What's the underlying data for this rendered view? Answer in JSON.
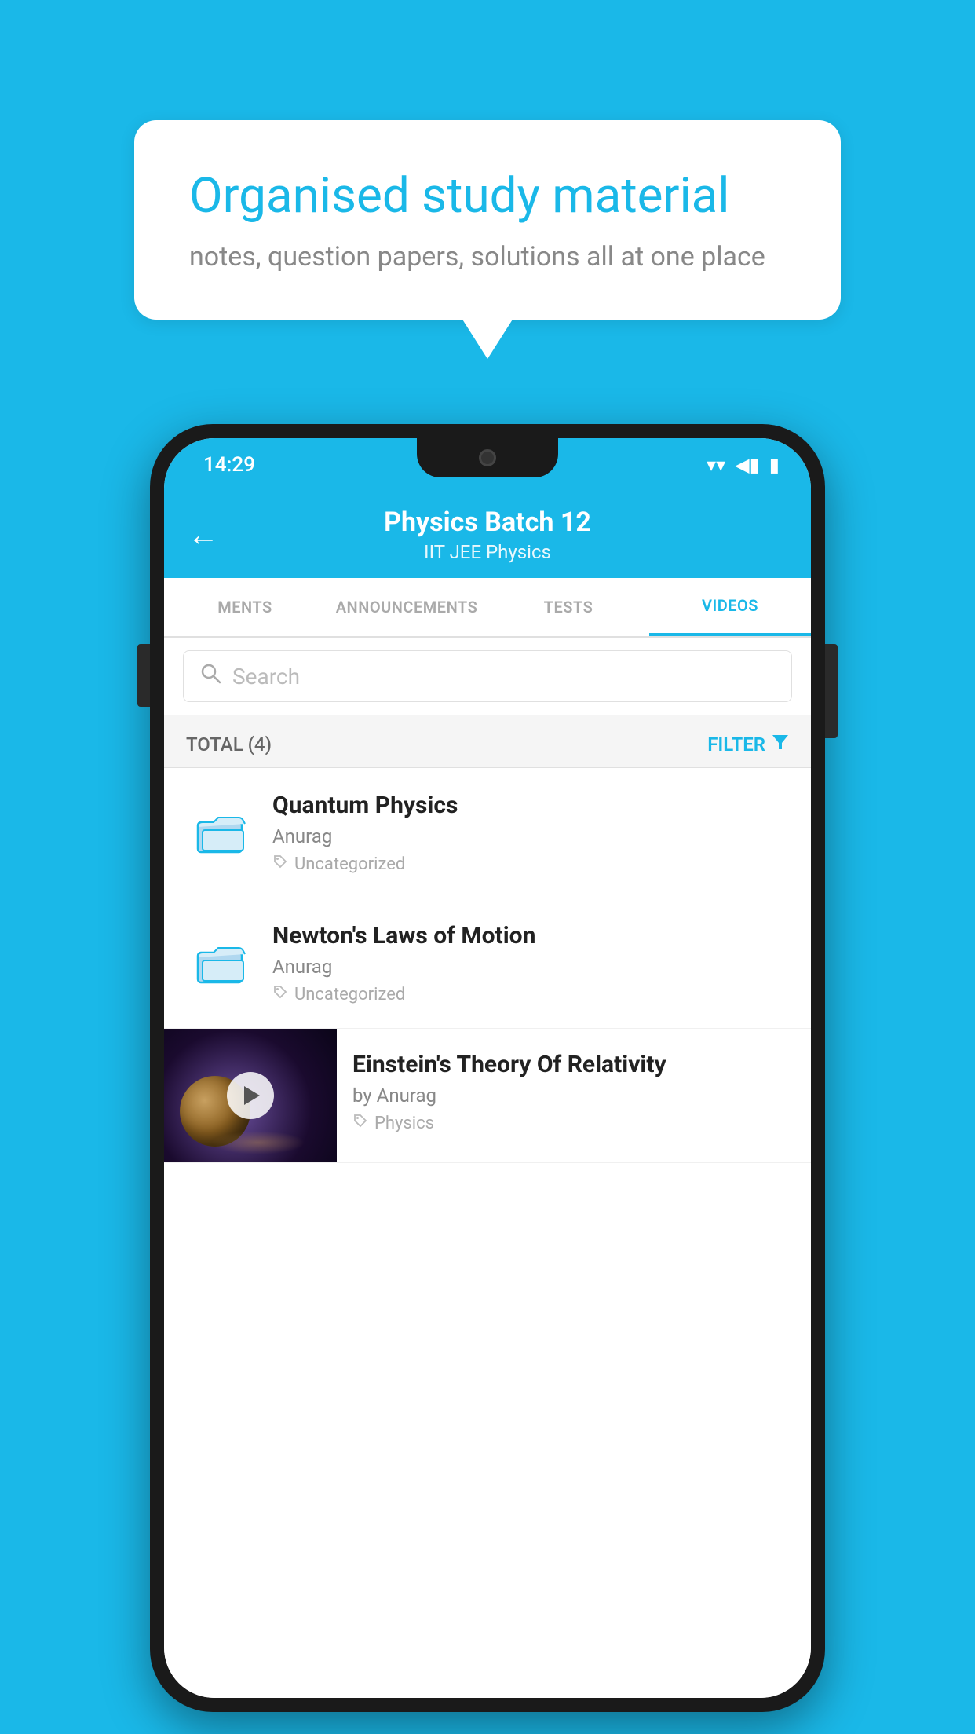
{
  "background_color": "#1ab8e8",
  "speech_bubble": {
    "title": "Organised study material",
    "subtitle": "notes, question papers, solutions all at one place"
  },
  "status_bar": {
    "time": "14:29",
    "wifi": "▼",
    "signal": "◀",
    "battery": "▮"
  },
  "header": {
    "title": "Physics Batch 12",
    "subtitle_tags": "IIT JEE    Physics",
    "back_label": "←"
  },
  "tabs": [
    {
      "label": "MENTS",
      "active": false
    },
    {
      "label": "ANNOUNCEMENTS",
      "active": false
    },
    {
      "label": "TESTS",
      "active": false
    },
    {
      "label": "VIDEOS",
      "active": true
    }
  ],
  "search": {
    "placeholder": "Search"
  },
  "filter_bar": {
    "total_label": "TOTAL (4)",
    "filter_label": "FILTER"
  },
  "list_items": [
    {
      "id": "quantum",
      "title": "Quantum Physics",
      "author": "Anurag",
      "tag": "Uncategorized",
      "has_thumb": false
    },
    {
      "id": "newton",
      "title": "Newton's Laws of Motion",
      "author": "Anurag",
      "tag": "Uncategorized",
      "has_thumb": false
    },
    {
      "id": "einstein",
      "title": "Einstein's Theory Of Relativity",
      "author": "by Anurag",
      "tag": "Physics",
      "has_thumb": true
    }
  ],
  "icons": {
    "back": "←",
    "search": "🔍",
    "filter": "▼",
    "tag": "🏷",
    "folder": "folder"
  }
}
